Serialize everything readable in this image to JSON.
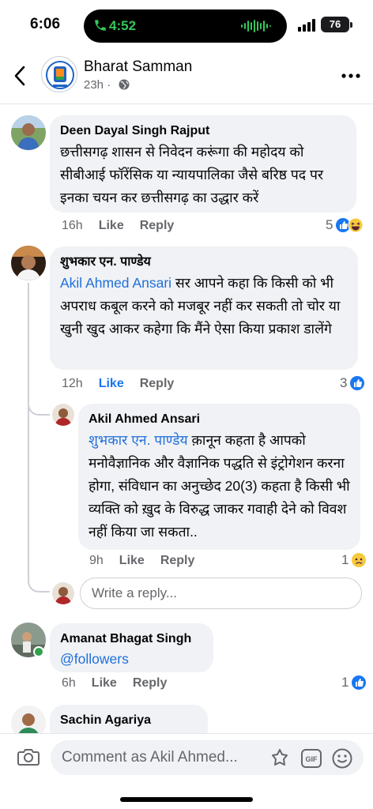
{
  "status_bar": {
    "time": "6:06",
    "call_time": "4:52",
    "battery": "76"
  },
  "header": {
    "page_name": "Bharat Samman",
    "post_age": "23h ·"
  },
  "comments": [
    {
      "author": "Deen Dayal Singh Rajput",
      "text": "छत्तीसगढ़ शासन से निवेदन करूंगा की महोदय को सीबीआई फॉरेंसिक या न्यायपालिका जैसे बरिष्ठ पद पर इनका चयन कर छत्तीसगढ़ का उद्धार करें",
      "time": "16h",
      "like": "Like",
      "reply": "Reply",
      "reaction_count": "5"
    },
    {
      "author": "शुभकार एन. पाण्डेय",
      "mention": "Akil Ahmed Ansari",
      "text": " सर आपने कहा कि किसी को भी अपराध कबूल करने को मजबूर नहीं कर सकती तो चोर या खुनी खुद आकर कहेगा कि मैंने ऐसा किया प्रकाश डालेंगे",
      "time": "12h",
      "like": "Like",
      "reply": "Reply",
      "reaction_count": "3"
    },
    {
      "author": "Akil Ahmed Ansari",
      "mention": "शुभकार एन. पाण्डेय",
      "text": " क़ानून कहता है आपको मनोवैज्ञानिक और वैज्ञानिक पद्धति से इंट्रोगेशन करना होगा, संविधान का अनुच्छेद 20(3) कहता है किसी भी व्यक्ति को ख़ुद के विरुद्ध जाकर गवाही देने को विवश नहीं किया जा सकता..",
      "time": "9h",
      "like": "Like",
      "reply": "Reply",
      "reaction_count": "1"
    },
    {
      "author": "Amanat Bhagat Singh",
      "mention": "@followers",
      "time": "6h",
      "like": "Like",
      "reply": "Reply",
      "reaction_count": "1"
    },
    {
      "author": "Sachin Agariya"
    }
  ],
  "reply_box": {
    "placeholder": "Write a reply..."
  },
  "composer": {
    "placeholder": "Comment as Akil Ahmed...",
    "gif_label": "GIF"
  },
  "colors": {
    "link": "#216fdb",
    "like_blue": "#1877f2",
    "bubble": "#f0f2f5",
    "call_green": "#34c759"
  }
}
